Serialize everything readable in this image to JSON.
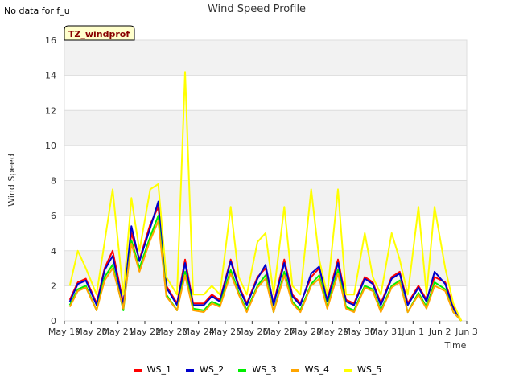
{
  "no_data_note": "No data for f_u",
  "chart_data": {
    "type": "line",
    "title": "Wind Speed Profile",
    "xlabel": "Time",
    "ylabel": "Wind Speed",
    "site_label": "TZ_windprof",
    "ylim": [
      0,
      16
    ],
    "yticks": [
      0,
      2,
      4,
      6,
      8,
      10,
      12,
      14,
      16
    ],
    "xticks": [
      "May 19",
      "May 20",
      "May 21",
      "May 22",
      "May 23",
      "May 24",
      "May 25",
      "May 26",
      "May 27",
      "May 28",
      "May 29",
      "May 30",
      "May 31",
      "Jun 1",
      "Jun 2",
      "Jun 3"
    ],
    "grid": true,
    "legend_position": "bottom",
    "x_days": [
      0.2,
      0.5,
      0.8,
      1.2,
      1.5,
      1.8,
      2.2,
      2.5,
      2.8,
      3.2,
      3.5,
      3.8,
      4.2,
      4.5,
      4.8,
      5.2,
      5.5,
      5.8,
      6.2,
      6.5,
      6.8,
      7.2,
      7.5,
      7.8,
      8.2,
      8.5,
      8.8,
      9.2,
      9.5,
      9.8,
      10.2,
      10.5,
      10.8,
      11.2,
      11.5,
      11.8,
      12.2,
      12.5,
      12.8,
      13.2,
      13.5,
      13.8,
      14.2,
      14.5,
      14.8
    ],
    "series": [
      {
        "name": "WS_1",
        "color": "#ff0000",
        "values": [
          1.2,
          2.2,
          2.4,
          1.0,
          3.0,
          4.0,
          1.0,
          5.0,
          3.5,
          5.5,
          6.5,
          2.0,
          1.0,
          3.5,
          1.0,
          1.0,
          1.5,
          1.2,
          3.5,
          2.0,
          1.0,
          2.5,
          3.0,
          1.0,
          3.5,
          1.5,
          1.0,
          2.5,
          3.0,
          1.2,
          3.5,
          1.2,
          1.0,
          2.5,
          2.2,
          1.0,
          2.5,
          2.8,
          1.0,
          2.0,
          1.2,
          2.5,
          2.2,
          0.8,
          0.0
        ]
      },
      {
        "name": "WS_2",
        "color": "#0000cc",
        "values": [
          1.1,
          2.1,
          2.3,
          0.9,
          2.9,
          3.7,
          0.9,
          5.4,
          3.4,
          5.3,
          6.8,
          1.9,
          0.9,
          3.3,
          0.9,
          0.9,
          1.4,
          1.1,
          3.4,
          1.9,
          0.9,
          2.4,
          3.2,
          0.9,
          3.3,
          1.4,
          0.9,
          2.7,
          3.1,
          1.1,
          3.3,
          1.1,
          0.9,
          2.4,
          2.1,
          0.9,
          2.4,
          2.7,
          0.9,
          1.9,
          1.1,
          2.8,
          2.1,
          0.7,
          0.0
        ]
      },
      {
        "name": "WS_3",
        "color": "#00ee00",
        "values": [
          0.9,
          1.8,
          2.0,
          0.6,
          2.5,
          3.2,
          0.6,
          4.6,
          3.0,
          4.8,
          6.0,
          1.5,
          0.6,
          2.8,
          0.7,
          0.6,
          1.1,
          0.9,
          2.9,
          1.6,
          0.6,
          2.0,
          2.6,
          0.5,
          2.8,
          1.1,
          0.6,
          2.1,
          2.6,
          0.8,
          2.9,
          0.8,
          0.6,
          2.0,
          1.8,
          0.6,
          2.0,
          2.3,
          0.5,
          1.6,
          0.8,
          2.2,
          1.8,
          0.5,
          0.0
        ]
      },
      {
        "name": "WS_4",
        "color": "#ffa500",
        "values": [
          0.8,
          1.7,
          1.9,
          0.6,
          2.3,
          3.0,
          0.7,
          4.4,
          2.8,
          4.6,
          5.7,
          1.4,
          0.6,
          2.6,
          0.6,
          0.5,
          1.0,
          0.8,
          2.7,
          1.5,
          0.5,
          1.9,
          2.4,
          0.5,
          2.6,
          1.0,
          0.5,
          2.0,
          2.4,
          0.7,
          2.7,
          0.7,
          0.5,
          1.9,
          1.7,
          0.5,
          1.9,
          2.2,
          0.5,
          1.5,
          0.7,
          2.0,
          1.7,
          0.5,
          0.0
        ]
      },
      {
        "name": "WS_5",
        "color": "#ffff00",
        "values": [
          2.0,
          4.0,
          3.0,
          1.5,
          4.5,
          7.5,
          1.5,
          7.0,
          4.0,
          7.5,
          7.8,
          2.5,
          1.5,
          14.2,
          1.5,
          1.5,
          2.0,
          1.5,
          6.5,
          2.5,
          1.5,
          4.5,
          5.0,
          1.5,
          6.5,
          2.0,
          1.5,
          7.5,
          3.5,
          1.5,
          7.5,
          1.5,
          1.5,
          5.0,
          2.5,
          1.5,
          5.0,
          3.5,
          1.5,
          6.5,
          1.5,
          6.5,
          3.0,
          1.0,
          0.0
        ]
      }
    ]
  }
}
